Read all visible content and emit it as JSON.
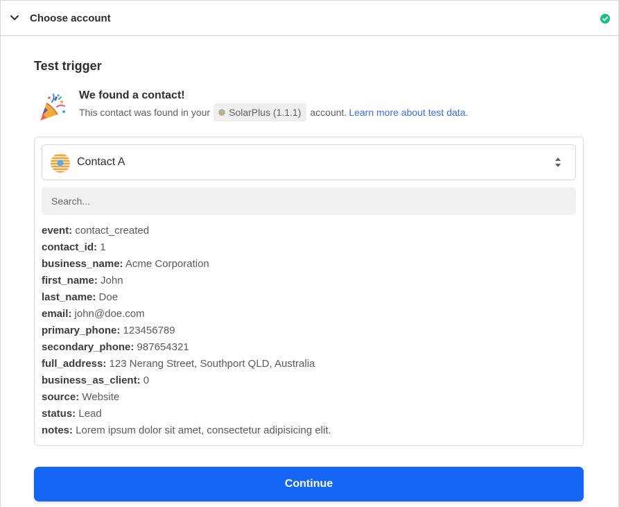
{
  "step": {
    "title": "Choose account",
    "complete": true
  },
  "section": {
    "title": "Test trigger"
  },
  "found": {
    "title": "We found a contact!",
    "desc_prefix": "This contact was found in your",
    "account_chip": "SolarPlus (1.1.1)",
    "desc_suffix": "account.",
    "link": "Learn more about test data."
  },
  "contact_select": {
    "value": "Contact A"
  },
  "search": {
    "placeholder": "Search..."
  },
  "fields": [
    {
      "key": "event:",
      "value": "contact_created"
    },
    {
      "key": "contact_id:",
      "value": "1"
    },
    {
      "key": "business_name:",
      "value": "Acme Corporation"
    },
    {
      "key": "first_name:",
      "value": "John"
    },
    {
      "key": "last_name:",
      "value": "Doe"
    },
    {
      "key": "email:",
      "value": "john@doe.com"
    },
    {
      "key": "primary_phone:",
      "value": "123456789"
    },
    {
      "key": "secondary_phone:",
      "value": "987654321"
    },
    {
      "key": "full_address:",
      "value": "123 Nerang Street, Southport QLD, Australia"
    },
    {
      "key": "business_as_client:",
      "value": "0"
    },
    {
      "key": "source:",
      "value": "Website"
    },
    {
      "key": "status:",
      "value": "Lead"
    },
    {
      "key": "notes:",
      "value": "Lorem ipsum dolor sit amet, consectetur adipisicing elit."
    }
  ],
  "continue_label": "Continue",
  "icons": {
    "collapse": "chevron-down-icon",
    "status": "check-circle-icon",
    "celebration": "party-popper-icon",
    "select_toggle": "up-down-arrows-icon"
  },
  "colors": {
    "primary": "#1466f5",
    "success": "#1bbf83",
    "link": "#3b6fde"
  }
}
